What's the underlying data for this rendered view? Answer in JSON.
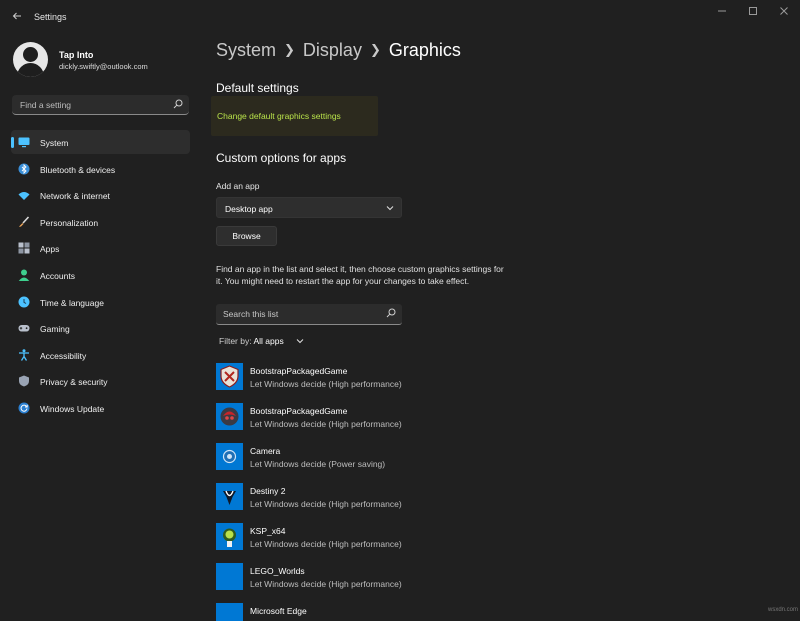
{
  "window": {
    "title": "Settings",
    "controls": [
      "minimize",
      "maximize",
      "close"
    ]
  },
  "profile": {
    "name": "Tap Into",
    "email": "dickly.swiftly@outlook.com"
  },
  "sidebar": {
    "search_placeholder": "Find a setting",
    "items": [
      {
        "label": "System",
        "icon": "monitor-icon",
        "active": true,
        "color": "#4cc2ff"
      },
      {
        "label": "Bluetooth & devices",
        "icon": "bluetooth-icon",
        "color": "#4cc2ff"
      },
      {
        "label": "Network & internet",
        "icon": "wifi-icon",
        "color": "#4cc2ff"
      },
      {
        "label": "Personalization",
        "icon": "brush-icon",
        "color": "#e8a35a"
      },
      {
        "label": "Apps",
        "icon": "apps-grid-icon",
        "color": "#b9c0cc"
      },
      {
        "label": "Accounts",
        "icon": "person-icon",
        "color": "#3ecf8e"
      },
      {
        "label": "Time & language",
        "icon": "globe-clock-icon",
        "color": "#4cc2ff"
      },
      {
        "label": "Gaming",
        "icon": "gamepad-icon",
        "color": "#b9c0cc"
      },
      {
        "label": "Accessibility",
        "icon": "accessibility-icon",
        "color": "#4cc2ff"
      },
      {
        "label": "Privacy & security",
        "icon": "shield-icon",
        "color": "#9aa4b4"
      },
      {
        "label": "Windows Update",
        "icon": "update-icon",
        "color": "#4cc2ff"
      }
    ]
  },
  "breadcrumb": {
    "items": [
      "System",
      "Display"
    ],
    "current": "Graphics"
  },
  "default_settings": {
    "title": "Default settings",
    "link": "Change default graphics settings",
    "link_color": "#b9e34a"
  },
  "custom": {
    "title": "Custom options for apps",
    "add_label": "Add an app",
    "dropdown_value": "Desktop app",
    "browse_label": "Browse",
    "description": "Find an app in the list and select it, then choose custom graphics settings for it. You might need to restart the app for your changes to take effect.",
    "list_search_placeholder": "Search this list",
    "filter_label": "Filter by:",
    "filter_value": "All apps"
  },
  "apps": [
    {
      "name": "BootstrapPackagedGame",
      "pref": "Let Windows decide (High performance)",
      "icon": "game-shield-icon"
    },
    {
      "name": "BootstrapPackagedGame",
      "pref": "Let Windows decide (High performance)",
      "icon": "game-helmet-icon"
    },
    {
      "name": "Camera",
      "pref": "Let Windows decide (Power saving)",
      "icon": "camera-icon"
    },
    {
      "name": "Destiny 2",
      "pref": "Let Windows decide (High performance)",
      "icon": "destiny-icon"
    },
    {
      "name": "KSP_x64",
      "pref": "Let Windows decide (High performance)",
      "icon": "ksp-icon"
    },
    {
      "name": "LEGO_Worlds",
      "pref": "Let Windows decide (High performance)",
      "icon": "lego-icon"
    },
    {
      "name": "Microsoft Edge",
      "pref": "",
      "icon": "edge-icon"
    }
  ],
  "watermark": "wsxdn.com"
}
